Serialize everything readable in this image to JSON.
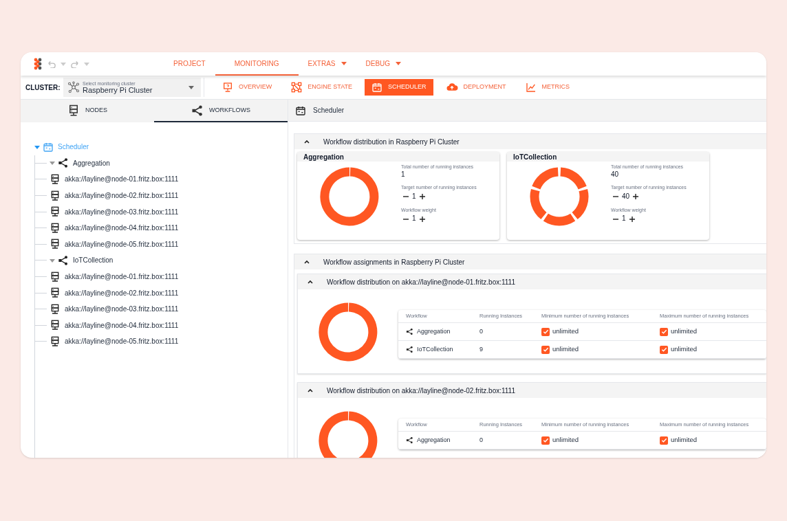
{
  "menu_tabs": [
    {
      "label": "PROJECT",
      "selected": false,
      "dropdown": false
    },
    {
      "label": "MONITORING",
      "selected": true,
      "dropdown": false
    },
    {
      "label": "EXTRAS",
      "selected": false,
      "dropdown": true
    },
    {
      "label": "DEBUG",
      "selected": false,
      "dropdown": true
    }
  ],
  "cluster": {
    "label": "CLUSTER:",
    "field_label": "Select monitoring cluster",
    "value": "Raspberry Pi Cluster"
  },
  "views": [
    {
      "label": "OVERVIEW",
      "kind": "monitor",
      "selected": false
    },
    {
      "label": "ENGINE STATE",
      "kind": "engine",
      "selected": false
    },
    {
      "label": "SCHEDULER",
      "kind": "calendar",
      "selected": true
    },
    {
      "label": "DEPLOYMENT",
      "kind": "cloud",
      "selected": false
    },
    {
      "label": "METRICS",
      "kind": "chart",
      "selected": false
    }
  ],
  "left_tabs": [
    {
      "label": "NODES",
      "kind": "server",
      "selected": false
    },
    {
      "label": "WORKFLOWS",
      "kind": "workflow",
      "selected": true
    }
  ],
  "tree": {
    "label": "Scheduler",
    "kind": "calendar",
    "expanded": true,
    "children": [
      {
        "label": "Aggregation",
        "kind": "workflow",
        "expanded": true,
        "children": [
          {
            "label": "akka://layline@node-01.fritz.box:1111",
            "kind": "server"
          },
          {
            "label": "akka://layline@node-02.fritz.box:1111",
            "kind": "server"
          },
          {
            "label": "akka://layline@node-03.fritz.box:1111",
            "kind": "server"
          },
          {
            "label": "akka://layline@node-04.fritz.box:1111",
            "kind": "server"
          },
          {
            "label": "akka://layline@node-05.fritz.box:1111",
            "kind": "server"
          }
        ]
      },
      {
        "label": "IoTCollection",
        "kind": "workflow",
        "expanded": true,
        "children": [
          {
            "label": "akka://layline@node-01.fritz.box:1111",
            "kind": "server"
          },
          {
            "label": "akka://layline@node-02.fritz.box:1111",
            "kind": "server"
          },
          {
            "label": "akka://layline@node-03.fritz.box:1111",
            "kind": "server"
          },
          {
            "label": "akka://layline@node-04.fritz.box:1111",
            "kind": "server"
          },
          {
            "label": "akka://layline@node-05.fritz.box:1111",
            "kind": "server"
          }
        ]
      }
    ]
  },
  "panel_title": "Scheduler",
  "distribution": {
    "title": "Workflow distribution in Raspberry Pi Cluster",
    "expanded": true,
    "cards": [
      {
        "title": "Aggregation",
        "segmented": false,
        "stats": [
          {
            "label": "Total number of running instances",
            "value": "1",
            "kind": "value"
          },
          {
            "label": "Target number of running instances",
            "value": "1",
            "kind": "stepper"
          },
          {
            "label": "Workflow weight",
            "value": "1",
            "kind": "stepper"
          }
        ]
      },
      {
        "title": "IoTCollection",
        "segmented": true,
        "stats": [
          {
            "label": "Total number of running instances",
            "value": "40",
            "kind": "value"
          },
          {
            "label": "Target number of running instances",
            "value": "40",
            "kind": "stepper"
          },
          {
            "label": "Workflow weight",
            "value": "1",
            "kind": "stepper"
          }
        ]
      }
    ]
  },
  "assignments": {
    "title": "Workflow assignments in Raspberry Pi Cluster",
    "expanded": true,
    "nodes": [
      {
        "title": "Workflow distribution on akka://layline@node-01.fritz.box:1111",
        "expanded": true,
        "segmented": false,
        "columns": [
          "Workflow",
          "Running Instances",
          "Minimum number of running instances",
          "Maximum number of running instances"
        ],
        "rows": [
          {
            "workflow": "Aggregation",
            "running": "0",
            "min": {
              "label": "unlimited",
              "checked": true
            },
            "max": {
              "label": "unlimited",
              "checked": true
            }
          },
          {
            "workflow": "IoTCollection",
            "running": "9",
            "min": {
              "label": "unlimited",
              "checked": true
            },
            "max": {
              "label": "unlimited",
              "checked": true
            }
          }
        ]
      },
      {
        "title": "Workflow distribution on akka://layline@node-02.fritz.box:1111",
        "expanded": true,
        "segmented": false,
        "columns": [
          "Workflow",
          "Running Instances",
          "Minimum number of running instances",
          "Maximum number of running instances"
        ],
        "rows": [
          {
            "workflow": "Aggregation",
            "running": "0",
            "min": {
              "label": "unlimited",
              "checked": true
            },
            "max": {
              "label": "unlimited",
              "checked": true
            }
          }
        ]
      }
    ]
  }
}
